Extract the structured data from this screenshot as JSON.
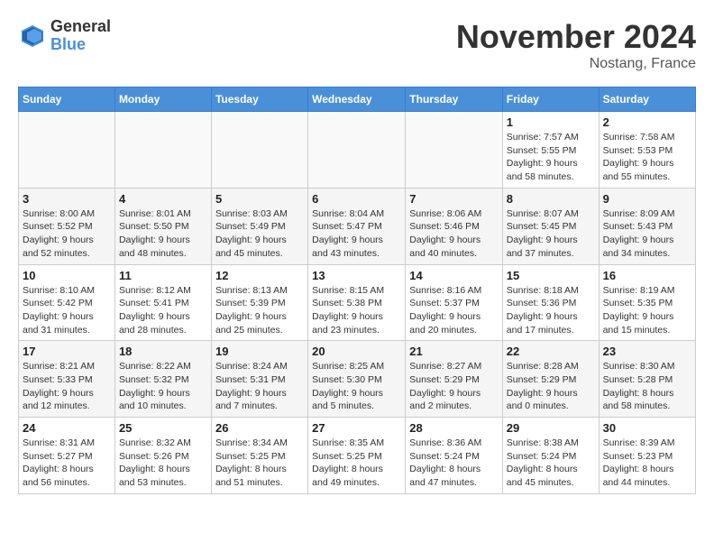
{
  "logo": {
    "general": "General",
    "blue": "Blue"
  },
  "title": "November 2024",
  "location": "Nostang, France",
  "days_of_week": [
    "Sunday",
    "Monday",
    "Tuesday",
    "Wednesday",
    "Thursday",
    "Friday",
    "Saturday"
  ],
  "weeks": [
    [
      {
        "day": "",
        "info": ""
      },
      {
        "day": "",
        "info": ""
      },
      {
        "day": "",
        "info": ""
      },
      {
        "day": "",
        "info": ""
      },
      {
        "day": "",
        "info": ""
      },
      {
        "day": "1",
        "info": "Sunrise: 7:57 AM\nSunset: 5:55 PM\nDaylight: 9 hours and 58 minutes."
      },
      {
        "day": "2",
        "info": "Sunrise: 7:58 AM\nSunset: 5:53 PM\nDaylight: 9 hours and 55 minutes."
      }
    ],
    [
      {
        "day": "3",
        "info": "Sunrise: 8:00 AM\nSunset: 5:52 PM\nDaylight: 9 hours and 52 minutes."
      },
      {
        "day": "4",
        "info": "Sunrise: 8:01 AM\nSunset: 5:50 PM\nDaylight: 9 hours and 48 minutes."
      },
      {
        "day": "5",
        "info": "Sunrise: 8:03 AM\nSunset: 5:49 PM\nDaylight: 9 hours and 45 minutes."
      },
      {
        "day": "6",
        "info": "Sunrise: 8:04 AM\nSunset: 5:47 PM\nDaylight: 9 hours and 43 minutes."
      },
      {
        "day": "7",
        "info": "Sunrise: 8:06 AM\nSunset: 5:46 PM\nDaylight: 9 hours and 40 minutes."
      },
      {
        "day": "8",
        "info": "Sunrise: 8:07 AM\nSunset: 5:45 PM\nDaylight: 9 hours and 37 minutes."
      },
      {
        "day": "9",
        "info": "Sunrise: 8:09 AM\nSunset: 5:43 PM\nDaylight: 9 hours and 34 minutes."
      }
    ],
    [
      {
        "day": "10",
        "info": "Sunrise: 8:10 AM\nSunset: 5:42 PM\nDaylight: 9 hours and 31 minutes."
      },
      {
        "day": "11",
        "info": "Sunrise: 8:12 AM\nSunset: 5:41 PM\nDaylight: 9 hours and 28 minutes."
      },
      {
        "day": "12",
        "info": "Sunrise: 8:13 AM\nSunset: 5:39 PM\nDaylight: 9 hours and 25 minutes."
      },
      {
        "day": "13",
        "info": "Sunrise: 8:15 AM\nSunset: 5:38 PM\nDaylight: 9 hours and 23 minutes."
      },
      {
        "day": "14",
        "info": "Sunrise: 8:16 AM\nSunset: 5:37 PM\nDaylight: 9 hours and 20 minutes."
      },
      {
        "day": "15",
        "info": "Sunrise: 8:18 AM\nSunset: 5:36 PM\nDaylight: 9 hours and 17 minutes."
      },
      {
        "day": "16",
        "info": "Sunrise: 8:19 AM\nSunset: 5:35 PM\nDaylight: 9 hours and 15 minutes."
      }
    ],
    [
      {
        "day": "17",
        "info": "Sunrise: 8:21 AM\nSunset: 5:33 PM\nDaylight: 9 hours and 12 minutes."
      },
      {
        "day": "18",
        "info": "Sunrise: 8:22 AM\nSunset: 5:32 PM\nDaylight: 9 hours and 10 minutes."
      },
      {
        "day": "19",
        "info": "Sunrise: 8:24 AM\nSunset: 5:31 PM\nDaylight: 9 hours and 7 minutes."
      },
      {
        "day": "20",
        "info": "Sunrise: 8:25 AM\nSunset: 5:30 PM\nDaylight: 9 hours and 5 minutes."
      },
      {
        "day": "21",
        "info": "Sunrise: 8:27 AM\nSunset: 5:29 PM\nDaylight: 9 hours and 2 minutes."
      },
      {
        "day": "22",
        "info": "Sunrise: 8:28 AM\nSunset: 5:29 PM\nDaylight: 9 hours and 0 minutes."
      },
      {
        "day": "23",
        "info": "Sunrise: 8:30 AM\nSunset: 5:28 PM\nDaylight: 8 hours and 58 minutes."
      }
    ],
    [
      {
        "day": "24",
        "info": "Sunrise: 8:31 AM\nSunset: 5:27 PM\nDaylight: 8 hours and 56 minutes."
      },
      {
        "day": "25",
        "info": "Sunrise: 8:32 AM\nSunset: 5:26 PM\nDaylight: 8 hours and 53 minutes."
      },
      {
        "day": "26",
        "info": "Sunrise: 8:34 AM\nSunset: 5:25 PM\nDaylight: 8 hours and 51 minutes."
      },
      {
        "day": "27",
        "info": "Sunrise: 8:35 AM\nSunset: 5:25 PM\nDaylight: 8 hours and 49 minutes."
      },
      {
        "day": "28",
        "info": "Sunrise: 8:36 AM\nSunset: 5:24 PM\nDaylight: 8 hours and 47 minutes."
      },
      {
        "day": "29",
        "info": "Sunrise: 8:38 AM\nSunset: 5:24 PM\nDaylight: 8 hours and 45 minutes."
      },
      {
        "day": "30",
        "info": "Sunrise: 8:39 AM\nSunset: 5:23 PM\nDaylight: 8 hours and 44 minutes."
      }
    ]
  ]
}
